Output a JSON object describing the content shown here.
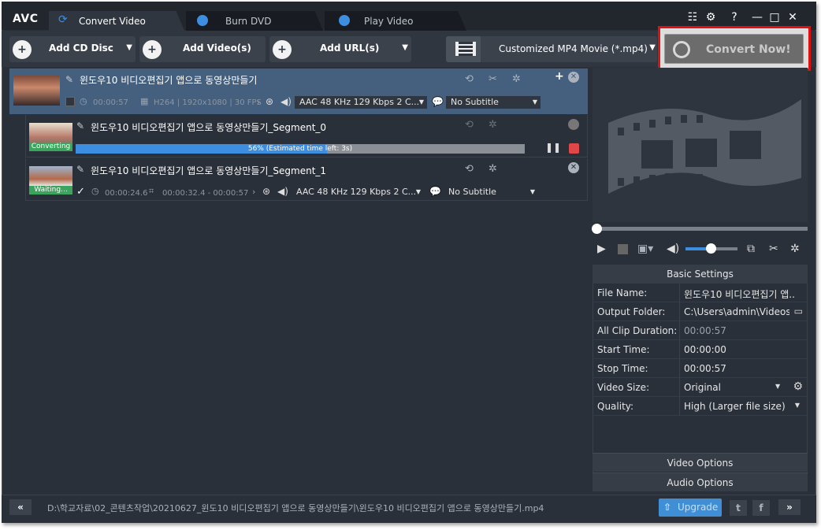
{
  "app": {
    "logo": "AVC"
  },
  "tabs": [
    {
      "label": "Convert Video",
      "active": true
    },
    {
      "label": "Burn DVD"
    },
    {
      "label": "Play Video"
    }
  ],
  "window_controls": {
    "help": "?",
    "minimize": "—",
    "maximize": "□",
    "close": "✕"
  },
  "toolbar": {
    "add_cd": "Add CD Disc",
    "add_video": "Add Video(s)",
    "add_url": "Add URL(s)",
    "profile": "Customized MP4 Movie (*.mp4)",
    "convert_now": "Convert Now!"
  },
  "main_item": {
    "title": "윈도우10 비디오편집기 앱으로 동영상만들기",
    "duration": "00:00:57",
    "video_info": "H264 | 1920x1080 | 30 FPS",
    "audio": "AAC 48 KHz 129 Kbps 2 C...",
    "subtitle": "No Subtitle"
  },
  "segment0": {
    "title": "윈도우10 비디오편집기 앱으로 동영상만들기_Segment_0",
    "status": "Converting",
    "progress_percent": 56,
    "progress_text": "56% (Estimated time left: 3s)"
  },
  "segment1": {
    "title": "윈도우10 비디오편집기 앱으로 동영상만들기_Segment_1",
    "status": "Waiting...",
    "duration": "00:00:24.6",
    "trim": "00:00:32.4 - 00:00:57",
    "audio": "AAC 48 KHz 129 Kbps 2 C...",
    "subtitle": "No Subtitle"
  },
  "settings": {
    "header": "Basic Settings",
    "rows": [
      {
        "key": "File Name:",
        "value": "윈도우10 비디오편집기 앱..."
      },
      {
        "key": "Output Folder:",
        "value": "C:\\Users\\admin\\Videos..."
      },
      {
        "key": "All Clip Duration:",
        "value": "00:00:57"
      },
      {
        "key": "Start Time:",
        "value": "00:00:00"
      },
      {
        "key": "Stop Time:",
        "value": "00:00:57"
      },
      {
        "key": "Video Size:",
        "value": "Original"
      },
      {
        "key": "Quality:",
        "value": "High (Larger file size)"
      }
    ],
    "video_options": "Video Options",
    "audio_options": "Audio Options"
  },
  "footer": {
    "path": "D:\\학교자료\\02_콘텐츠작업\\20210627_윈도10  비디오편집기 앱으로 동영상만들기\\윈도우10 비디오편집기 앱으로 동영상만들기.mp4",
    "upgrade": "Upgrade",
    "prev": "«",
    "next": "»"
  },
  "colors": {
    "accent": "#3d8ee0",
    "highlight_border": "#e01010",
    "converting": "#3ba55d",
    "selected_row": "#45607f"
  }
}
